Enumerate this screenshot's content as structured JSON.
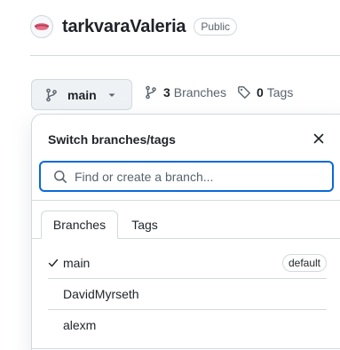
{
  "repo": {
    "owner_avatar_icon": "lips-avatar-icon",
    "name": "tarkvaraValeria",
    "visibility": "Public"
  },
  "branch_selector": {
    "current_branch": "main",
    "icon": "git-branch-icon",
    "caret_icon": "triangle-down-icon"
  },
  "counts": {
    "branches_count": "3",
    "branches_label": "Branches",
    "tags_count": "0",
    "tags_label": "Tags"
  },
  "dropdown": {
    "title": "Switch branches/tags",
    "search_placeholder": "Find or create a branch...",
    "tabs": [
      {
        "label": "Branches",
        "active": true
      },
      {
        "label": "Tags",
        "active": false
      }
    ],
    "branches": [
      {
        "name": "main",
        "selected": true,
        "badge": "default"
      },
      {
        "name": "DavidMyrseth",
        "selected": false
      },
      {
        "name": "alexm",
        "selected": false
      }
    ]
  },
  "colors": {
    "accent_focus": "#0969da",
    "text_primary": "#1f2328",
    "text_muted": "#59636e",
    "border": "#d1d9e0",
    "button_bg": "#eff2f5"
  }
}
